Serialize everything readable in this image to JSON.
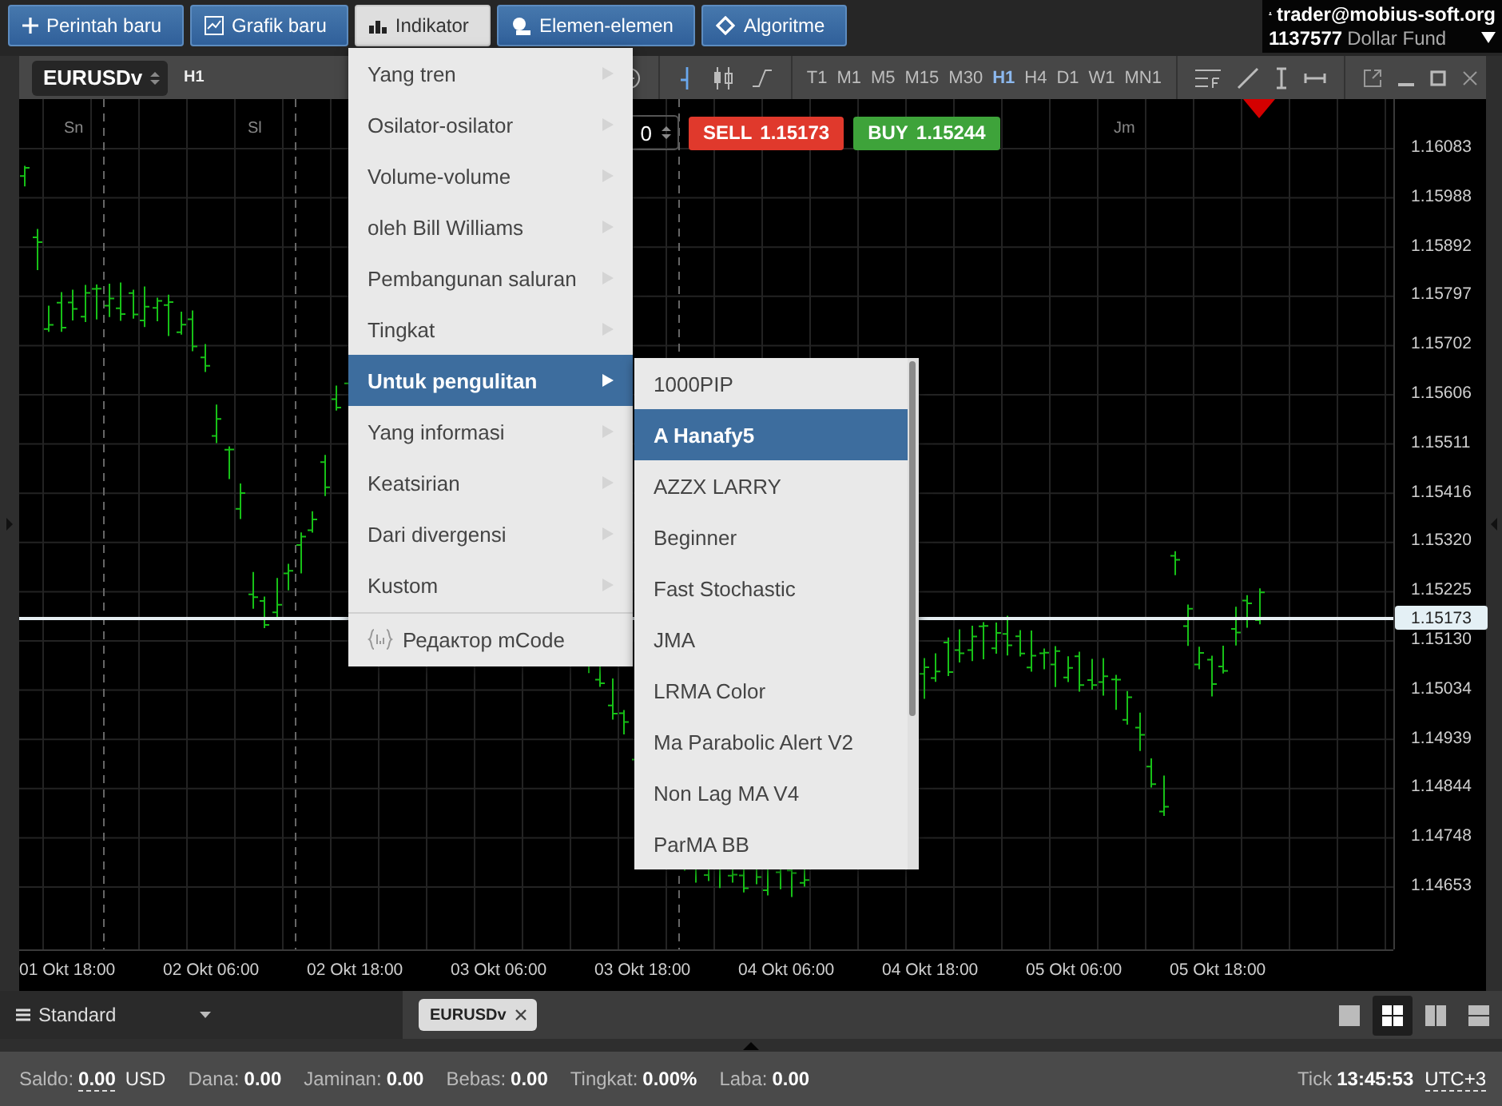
{
  "top_bar": {
    "buttons": [
      {
        "label": "Perintah baru",
        "kind": "plus",
        "selected": false
      },
      {
        "label": "Grafik baru",
        "kind": "chart",
        "selected": false
      },
      {
        "label": "Indikator",
        "kind": "bars",
        "selected": true
      },
      {
        "label": "Elemen-elemen",
        "kind": "shapes",
        "selected": false
      },
      {
        "label": "Algoritme",
        "kind": "diamond",
        "selected": false
      }
    ],
    "account": {
      "email": "trader@mobius-soft.org",
      "number": "1137577",
      "name": "Dollar Fund"
    }
  },
  "chart_window": {
    "symbol": "EURUSDv",
    "period": "H1",
    "timeframes": [
      {
        "label": "T1",
        "selected": false
      },
      {
        "label": "M1",
        "selected": false
      },
      {
        "label": "M5",
        "selected": false
      },
      {
        "label": "M15",
        "selected": false
      },
      {
        "label": "M30",
        "selected": false
      },
      {
        "label": "H1",
        "selected": true
      },
      {
        "label": "H4",
        "selected": false
      },
      {
        "label": "D1",
        "selected": false
      },
      {
        "label": "W1",
        "selected": false
      },
      {
        "label": "MN1",
        "selected": false
      }
    ],
    "order": {
      "volume": "0",
      "sell": {
        "label": "SELL",
        "price": "1.15173"
      },
      "buy": {
        "label": "BUY",
        "price": "1.15244"
      }
    },
    "day_labels": [
      "Sn",
      "Sl",
      "Jm"
    ],
    "price_ticks": [
      "1.16083",
      "1.15988",
      "1.15892",
      "1.15797",
      "1.15702",
      "1.15606",
      "1.15511",
      "1.15416",
      "1.15320",
      "1.15225",
      "1.15130",
      "1.15034",
      "1.14939",
      "1.14844",
      "1.14748",
      "1.14653"
    ],
    "current_price": "1.15173",
    "time_labels": [
      "01 Okt 18:00",
      "02 Okt 06:00",
      "02 Okt 18:00",
      "03 Okt 06:00",
      "03 Okt 18:00",
      "04 Okt 06:00",
      "04 Okt 18:00",
      "05 Okt 06:00",
      "05 Okt 18:00"
    ]
  },
  "indicator_menu": {
    "items": [
      {
        "label": "Yang tren",
        "selected": false
      },
      {
        "label": "Osilator-osilator",
        "selected": false
      },
      {
        "label": "Volume-volume",
        "selected": false
      },
      {
        "label": "oleh Bill Williams",
        "selected": false
      },
      {
        "label": "Pembangunan saluran",
        "selected": false
      },
      {
        "label": "Tingkat",
        "selected": false
      },
      {
        "label": "Untuk pengulitan",
        "selected": true
      },
      {
        "label": "Yang informasi",
        "selected": false
      },
      {
        "label": "Keatsirian",
        "selected": false
      },
      {
        "label": "Dari divergensi",
        "selected": false
      },
      {
        "label": "Kustom",
        "selected": false
      }
    ],
    "editor_item": "Редактор mCode"
  },
  "submenu": {
    "items": [
      {
        "label": "1000PIP",
        "selected": false
      },
      {
        "label": "A Hanafy5",
        "selected": true
      },
      {
        "label": "AZZX LARRY",
        "selected": false
      },
      {
        "label": "Beginner",
        "selected": false
      },
      {
        "label": "Fast Stochastic",
        "selected": false
      },
      {
        "label": "JMA",
        "selected": false
      },
      {
        "label": "LRMA Color",
        "selected": false
      },
      {
        "label": "Ma Parabolic Alert V2",
        "selected": false
      },
      {
        "label": "Non Lag MA V4",
        "selected": false
      },
      {
        "label": "ParMA BB",
        "selected": false
      }
    ]
  },
  "bottom_bar": {
    "template": "Standard",
    "tabs": [
      {
        "label": "EURUSDv",
        "selected": true
      }
    ],
    "layouts": [
      {
        "kind": "single",
        "selected": false
      },
      {
        "kind": "grid",
        "selected": true
      },
      {
        "kind": "columns",
        "selected": false
      },
      {
        "kind": "rows",
        "selected": false
      }
    ]
  },
  "status_bar": {
    "fields": [
      {
        "label": "Saldo:",
        "value": "0.00",
        "unit": "USD",
        "kind": "underlined"
      },
      {
        "label": "Dana:",
        "value": "0.00",
        "kind": "plain"
      },
      {
        "label": "Jaminan:",
        "value": "0.00",
        "kind": "plain"
      },
      {
        "label": "Bebas:",
        "value": "0.00",
        "kind": "plain"
      },
      {
        "label": "Tingkat:",
        "value": "0.00%",
        "kind": "plain"
      },
      {
        "label": "Laba:",
        "value": "0.00",
        "kind": "plain"
      }
    ],
    "tick_label": "Tick",
    "time": "13:45:53",
    "timezone": "UTC+3"
  }
}
